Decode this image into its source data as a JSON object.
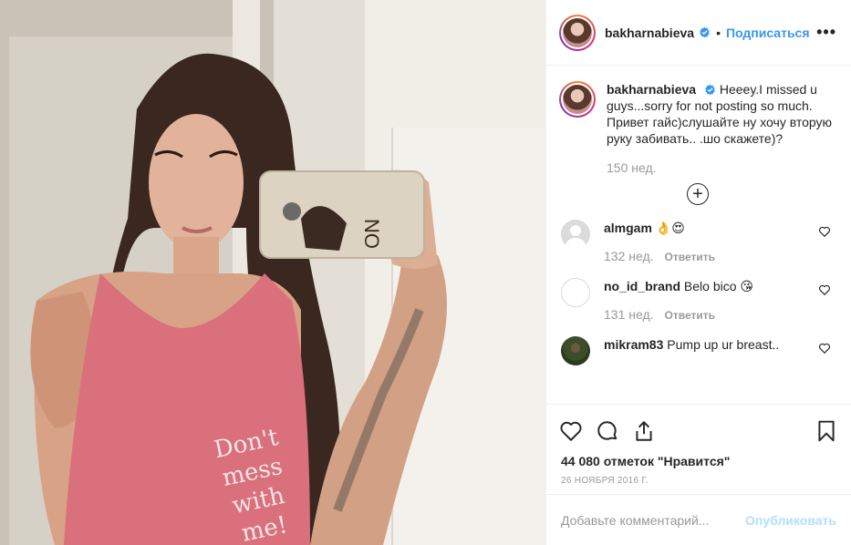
{
  "post": {
    "author": "bakharnabieva",
    "follow_label": "Подписаться",
    "more_label": "•••",
    "dot": "•",
    "shirt_text": [
      "Don't",
      "mess",
      "with",
      "me!"
    ]
  },
  "caption": {
    "username": "bakharnabieva",
    "text": "Heeey.I missed u guys...sorry for not posting so much. Привет гайс)слушайте ну хочу вторую руку забивать.. .шо скажете)?",
    "time": "150 нед.",
    "plus": "+"
  },
  "comments": [
    {
      "username": "almgam",
      "text": "👌😍",
      "time": "132 нед.",
      "reply": "Ответить",
      "avatar": "gray"
    },
    {
      "username": "no_id_brand",
      "text": "Belo bico 😘",
      "time": "131 нед.",
      "reply": "Ответить",
      "avatar": "white"
    },
    {
      "username": "mikram83",
      "text": "Pump up ur breast..",
      "time": "",
      "reply": "",
      "avatar": "photo"
    }
  ],
  "stats": {
    "likes": "44 080 отметок \"Нравится\"",
    "date": "26 НОЯБРЯ 2016 Г."
  },
  "add_comment": {
    "placeholder": "Добавьте комментарий...",
    "publish": "Опубликовать"
  },
  "colors": {
    "accent": "#3897f0",
    "publish_disabled": "#b2dffc",
    "muted": "#999999",
    "border": "#efefef",
    "shirt": "#d9707c"
  },
  "icons": [
    "verified-badge-icon",
    "more-icon",
    "add-icon",
    "heart-icon",
    "comment-icon",
    "share-icon",
    "bookmark-icon"
  ]
}
